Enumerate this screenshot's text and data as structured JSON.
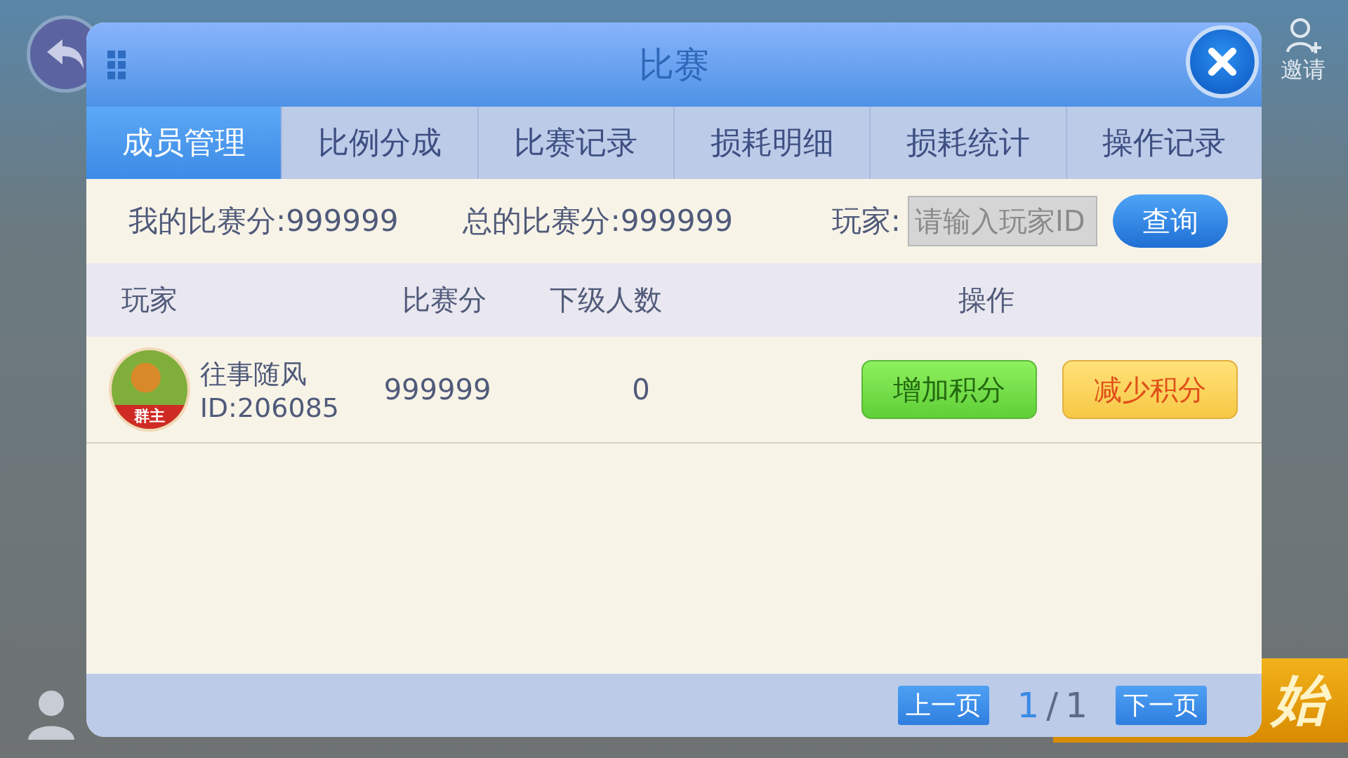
{
  "background": {
    "invite_label": "邀请",
    "start_label": "始"
  },
  "dialog": {
    "title": "比赛"
  },
  "tabs": [
    {
      "label": "成员管理",
      "selected": true
    },
    {
      "label": "比例分成",
      "selected": false
    },
    {
      "label": "比赛记录",
      "selected": false
    },
    {
      "label": "损耗明细",
      "selected": false
    },
    {
      "label": "损耗统计",
      "selected": false
    },
    {
      "label": "操作记录",
      "selected": false
    }
  ],
  "summary": {
    "my_score": "我的比赛分:999999",
    "total_score": "总的比赛分:999999",
    "player_label": "玩家:",
    "search_placeholder": "请输入玩家ID",
    "query_button": "查询"
  },
  "table": {
    "columns": [
      "玩家",
      "比赛分",
      "下级人数",
      "操作"
    ],
    "rows": [
      {
        "name": "往事随风",
        "id": "ID:206085",
        "badge": "群主",
        "score": "999999",
        "subordinates": "0",
        "actions": [
          {
            "kind": "add",
            "label": "增加积分"
          },
          {
            "kind": "subtract",
            "label": "减少积分"
          }
        ]
      }
    ]
  },
  "pagination": {
    "prev": "上一页",
    "current": "1",
    "separator": "/",
    "total": "1",
    "next": "下一页"
  }
}
